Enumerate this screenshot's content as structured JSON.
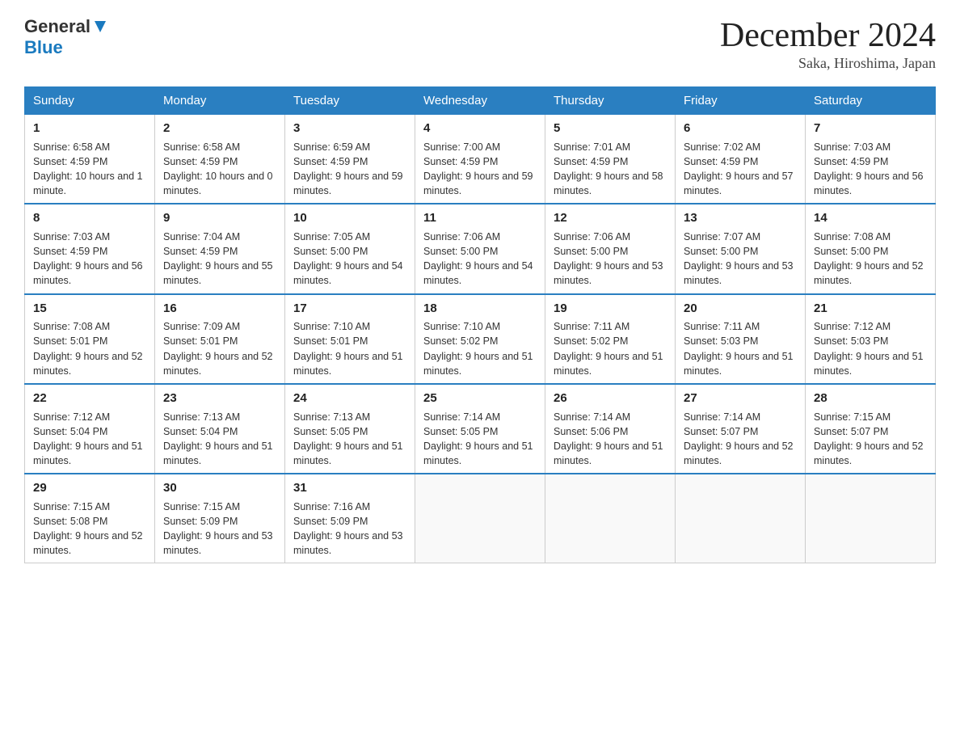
{
  "header": {
    "logo_general": "General",
    "logo_blue": "Blue",
    "month_title": "December 2024",
    "subtitle": "Saka, Hiroshima, Japan"
  },
  "days_of_week": [
    "Sunday",
    "Monday",
    "Tuesday",
    "Wednesday",
    "Thursday",
    "Friday",
    "Saturday"
  ],
  "weeks": [
    [
      {
        "day": "1",
        "sunrise": "6:58 AM",
        "sunset": "4:59 PM",
        "daylight": "10 hours and 1 minute."
      },
      {
        "day": "2",
        "sunrise": "6:58 AM",
        "sunset": "4:59 PM",
        "daylight": "10 hours and 0 minutes."
      },
      {
        "day": "3",
        "sunrise": "6:59 AM",
        "sunset": "4:59 PM",
        "daylight": "9 hours and 59 minutes."
      },
      {
        "day": "4",
        "sunrise": "7:00 AM",
        "sunset": "4:59 PM",
        "daylight": "9 hours and 59 minutes."
      },
      {
        "day": "5",
        "sunrise": "7:01 AM",
        "sunset": "4:59 PM",
        "daylight": "9 hours and 58 minutes."
      },
      {
        "day": "6",
        "sunrise": "7:02 AM",
        "sunset": "4:59 PM",
        "daylight": "9 hours and 57 minutes."
      },
      {
        "day": "7",
        "sunrise": "7:03 AM",
        "sunset": "4:59 PM",
        "daylight": "9 hours and 56 minutes."
      }
    ],
    [
      {
        "day": "8",
        "sunrise": "7:03 AM",
        "sunset": "4:59 PM",
        "daylight": "9 hours and 56 minutes."
      },
      {
        "day": "9",
        "sunrise": "7:04 AM",
        "sunset": "4:59 PM",
        "daylight": "9 hours and 55 minutes."
      },
      {
        "day": "10",
        "sunrise": "7:05 AM",
        "sunset": "5:00 PM",
        "daylight": "9 hours and 54 minutes."
      },
      {
        "day": "11",
        "sunrise": "7:06 AM",
        "sunset": "5:00 PM",
        "daylight": "9 hours and 54 minutes."
      },
      {
        "day": "12",
        "sunrise": "7:06 AM",
        "sunset": "5:00 PM",
        "daylight": "9 hours and 53 minutes."
      },
      {
        "day": "13",
        "sunrise": "7:07 AM",
        "sunset": "5:00 PM",
        "daylight": "9 hours and 53 minutes."
      },
      {
        "day": "14",
        "sunrise": "7:08 AM",
        "sunset": "5:00 PM",
        "daylight": "9 hours and 52 minutes."
      }
    ],
    [
      {
        "day": "15",
        "sunrise": "7:08 AM",
        "sunset": "5:01 PM",
        "daylight": "9 hours and 52 minutes."
      },
      {
        "day": "16",
        "sunrise": "7:09 AM",
        "sunset": "5:01 PM",
        "daylight": "9 hours and 52 minutes."
      },
      {
        "day": "17",
        "sunrise": "7:10 AM",
        "sunset": "5:01 PM",
        "daylight": "9 hours and 51 minutes."
      },
      {
        "day": "18",
        "sunrise": "7:10 AM",
        "sunset": "5:02 PM",
        "daylight": "9 hours and 51 minutes."
      },
      {
        "day": "19",
        "sunrise": "7:11 AM",
        "sunset": "5:02 PM",
        "daylight": "9 hours and 51 minutes."
      },
      {
        "day": "20",
        "sunrise": "7:11 AM",
        "sunset": "5:03 PM",
        "daylight": "9 hours and 51 minutes."
      },
      {
        "day": "21",
        "sunrise": "7:12 AM",
        "sunset": "5:03 PM",
        "daylight": "9 hours and 51 minutes."
      }
    ],
    [
      {
        "day": "22",
        "sunrise": "7:12 AM",
        "sunset": "5:04 PM",
        "daylight": "9 hours and 51 minutes."
      },
      {
        "day": "23",
        "sunrise": "7:13 AM",
        "sunset": "5:04 PM",
        "daylight": "9 hours and 51 minutes."
      },
      {
        "day": "24",
        "sunrise": "7:13 AM",
        "sunset": "5:05 PM",
        "daylight": "9 hours and 51 minutes."
      },
      {
        "day": "25",
        "sunrise": "7:14 AM",
        "sunset": "5:05 PM",
        "daylight": "9 hours and 51 minutes."
      },
      {
        "day": "26",
        "sunrise": "7:14 AM",
        "sunset": "5:06 PM",
        "daylight": "9 hours and 51 minutes."
      },
      {
        "day": "27",
        "sunrise": "7:14 AM",
        "sunset": "5:07 PM",
        "daylight": "9 hours and 52 minutes."
      },
      {
        "day": "28",
        "sunrise": "7:15 AM",
        "sunset": "5:07 PM",
        "daylight": "9 hours and 52 minutes."
      }
    ],
    [
      {
        "day": "29",
        "sunrise": "7:15 AM",
        "sunset": "5:08 PM",
        "daylight": "9 hours and 52 minutes."
      },
      {
        "day": "30",
        "sunrise": "7:15 AM",
        "sunset": "5:09 PM",
        "daylight": "9 hours and 53 minutes."
      },
      {
        "day": "31",
        "sunrise": "7:16 AM",
        "sunset": "5:09 PM",
        "daylight": "9 hours and 53 minutes."
      },
      null,
      null,
      null,
      null
    ]
  ],
  "labels": {
    "sunrise": "Sunrise:",
    "sunset": "Sunset:",
    "daylight": "Daylight:"
  }
}
